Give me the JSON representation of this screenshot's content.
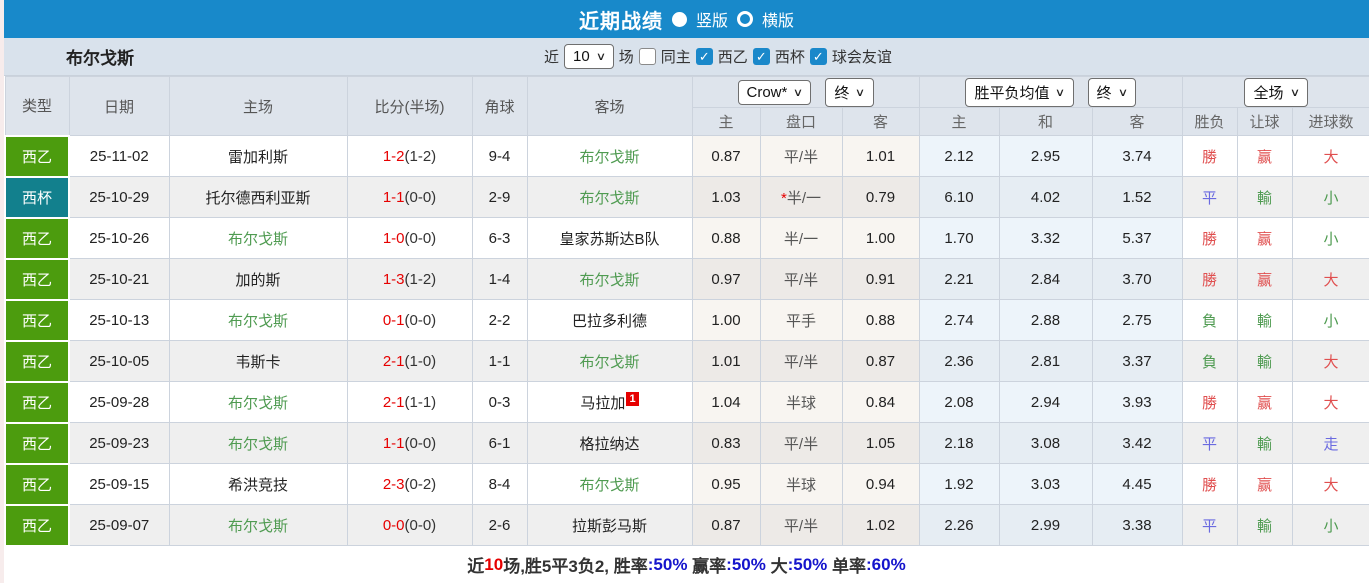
{
  "colors": {
    "topbar_blue": "#1889ca",
    "filterbar_bg": "#d9e2ec",
    "header_bg": "#dee4ec",
    "league_green": "#4c9c0e",
    "cup_teal": "#12808d",
    "score_red": "#e60000",
    "self_team_green": "#4f9b51",
    "result_red": "#e04f4f",
    "result_blue": "#6a6ae0",
    "result_green": "#4f9b51",
    "footer_blue": "#1414cc"
  },
  "top_bar": {
    "title": "近期战绩",
    "vertical_label": "竖版",
    "horizontal_label": "横版"
  },
  "filter_bar": {
    "team": "布尔戈斯",
    "near_label": "近",
    "count": "10",
    "games_label": "场",
    "same_home_label": "同主",
    "league_1": "西乙",
    "league_2": "西杯",
    "league_3": "球会友谊"
  },
  "table": {
    "headers_left": [
      "类型",
      "日期",
      "主场",
      "比分(半场)",
      "角球",
      "客场"
    ],
    "crow_dropdown": "Crow*",
    "crow_time_dropdown": "终",
    "mean_dropdown": "胜平负均值",
    "mean_time_dropdown": "终",
    "scope_dropdown": "全场",
    "sub_headers": [
      "主",
      "盘口",
      "客",
      "主",
      "和",
      "客",
      "胜负",
      "让球",
      "进球数"
    ],
    "rows": [
      {
        "type": "西乙",
        "type_color": "green",
        "date": "25-11-02",
        "home": "雷加利斯",
        "home_self": "false",
        "score": "1-2",
        "half": "(1-2)",
        "corner": "9-4",
        "away": "布尔戈斯",
        "away_self": "true",
        "away_card": "",
        "crow_home": "0.87",
        "pan_star": "",
        "pan": "平/半",
        "crow_away": "1.01",
        "mean_home": "2.12",
        "mean_draw": "2.95",
        "mean_away": "3.74",
        "wdl": "勝",
        "wdl_color": "red",
        "let": "赢",
        "let_color": "red",
        "goal": "大",
        "goal_color": "red"
      },
      {
        "type": "西杯",
        "type_color": "teal",
        "date": "25-10-29",
        "home": "托尔德西利亚斯",
        "home_self": "false",
        "score": "1-1",
        "half": "(0-0)",
        "corner": "2-9",
        "away": "布尔戈斯",
        "away_self": "true",
        "away_card": "",
        "crow_home": "1.03",
        "pan_star": "*",
        "pan": "半/一",
        "crow_away": "0.79",
        "mean_home": "6.10",
        "mean_draw": "4.02",
        "mean_away": "1.52",
        "wdl": "平",
        "wdl_color": "blue",
        "let": "輸",
        "let_color": "green",
        "goal": "小",
        "goal_color": "green"
      },
      {
        "type": "西乙",
        "type_color": "green",
        "date": "25-10-26",
        "home": "布尔戈斯",
        "home_self": "true",
        "score": "1-0",
        "half": "(0-0)",
        "corner": "6-3",
        "away": "皇家苏斯达B队",
        "away_self": "false",
        "away_card": "",
        "crow_home": "0.88",
        "pan_star": "",
        "pan": "半/一",
        "crow_away": "1.00",
        "mean_home": "1.70",
        "mean_draw": "3.32",
        "mean_away": "5.37",
        "wdl": "勝",
        "wdl_color": "red",
        "let": "赢",
        "let_color": "red",
        "goal": "小",
        "goal_color": "green"
      },
      {
        "type": "西乙",
        "type_color": "green",
        "date": "25-10-21",
        "home": "加的斯",
        "home_self": "false",
        "score": "1-3",
        "half": "(1-2)",
        "corner": "1-4",
        "away": "布尔戈斯",
        "away_self": "true",
        "away_card": "",
        "crow_home": "0.97",
        "pan_star": "",
        "pan": "平/半",
        "crow_away": "0.91",
        "mean_home": "2.21",
        "mean_draw": "2.84",
        "mean_away": "3.70",
        "wdl": "勝",
        "wdl_color": "red",
        "let": "赢",
        "let_color": "red",
        "goal": "大",
        "goal_color": "red"
      },
      {
        "type": "西乙",
        "type_color": "green",
        "date": "25-10-13",
        "home": "布尔戈斯",
        "home_self": "true",
        "score": "0-1",
        "half": "(0-0)",
        "corner": "2-2",
        "away": "巴拉多利德",
        "away_self": "false",
        "away_card": "",
        "crow_home": "1.00",
        "pan_star": "",
        "pan": "平手",
        "crow_away": "0.88",
        "mean_home": "2.74",
        "mean_draw": "2.88",
        "mean_away": "2.75",
        "wdl": "負",
        "wdl_color": "green",
        "let": "輸",
        "let_color": "green",
        "goal": "小",
        "goal_color": "green"
      },
      {
        "type": "西乙",
        "type_color": "green",
        "date": "25-10-05",
        "home": "韦斯卡",
        "home_self": "false",
        "score": "2-1",
        "half": "(1-0)",
        "corner": "1-1",
        "away": "布尔戈斯",
        "away_self": "true",
        "away_card": "",
        "crow_home": "1.01",
        "pan_star": "",
        "pan": "平/半",
        "crow_away": "0.87",
        "mean_home": "2.36",
        "mean_draw": "2.81",
        "mean_away": "3.37",
        "wdl": "負",
        "wdl_color": "green",
        "let": "輸",
        "let_color": "green",
        "goal": "大",
        "goal_color": "red"
      },
      {
        "type": "西乙",
        "type_color": "green",
        "date": "25-09-28",
        "home": "布尔戈斯",
        "home_self": "true",
        "score": "2-1",
        "half": "(1-1)",
        "corner": "0-3",
        "away": "马拉加",
        "away_self": "false",
        "away_card": "1",
        "crow_home": "1.04",
        "pan_star": "",
        "pan": "半球",
        "crow_away": "0.84",
        "mean_home": "2.08",
        "mean_draw": "2.94",
        "mean_away": "3.93",
        "wdl": "勝",
        "wdl_color": "red",
        "let": "赢",
        "let_color": "red",
        "goal": "大",
        "goal_color": "red"
      },
      {
        "type": "西乙",
        "type_color": "green",
        "date": "25-09-23",
        "home": "布尔戈斯",
        "home_self": "true",
        "score": "1-1",
        "half": "(0-0)",
        "corner": "6-1",
        "away": "格拉纳达",
        "away_self": "false",
        "away_card": "",
        "crow_home": "0.83",
        "pan_star": "",
        "pan": "平/半",
        "crow_away": "1.05",
        "mean_home": "2.18",
        "mean_draw": "3.08",
        "mean_away": "3.42",
        "wdl": "平",
        "wdl_color": "blue",
        "let": "輸",
        "let_color": "green",
        "goal": "走",
        "goal_color": "blue"
      },
      {
        "type": "西乙",
        "type_color": "green",
        "date": "25-09-15",
        "home": "希洪竞技",
        "home_self": "false",
        "score": "2-3",
        "half": "(0-2)",
        "corner": "8-4",
        "away": "布尔戈斯",
        "away_self": "true",
        "away_card": "",
        "crow_home": "0.95",
        "pan_star": "",
        "pan": "半球",
        "crow_away": "0.94",
        "mean_home": "1.92",
        "mean_draw": "3.03",
        "mean_away": "4.45",
        "wdl": "勝",
        "wdl_color": "red",
        "let": "赢",
        "let_color": "red",
        "goal": "大",
        "goal_color": "red"
      },
      {
        "type": "西乙",
        "type_color": "green",
        "date": "25-09-07",
        "home": "布尔戈斯",
        "home_self": "true",
        "score": "0-0",
        "half": "(0-0)",
        "corner": "2-6",
        "away": "拉斯彭马斯",
        "away_self": "false",
        "away_card": "",
        "crow_home": "0.87",
        "pan_star": "",
        "pan": "平/半",
        "crow_away": "1.02",
        "mean_home": "2.26",
        "mean_draw": "2.99",
        "mean_away": "3.38",
        "wdl": "平",
        "wdl_color": "blue",
        "let": "輸",
        "let_color": "green",
        "goal": "小",
        "goal_color": "green"
      }
    ]
  },
  "footer": {
    "segments": [
      {
        "text": "近",
        "color": "dark"
      },
      {
        "text": "10",
        "color": "red"
      },
      {
        "text": "场,胜5平3负2, ",
        "color": "dark"
      },
      {
        "text": "胜率",
        "color": "dark"
      },
      {
        "text": ":50%",
        "color": "blue"
      },
      {
        "text": " 赢率",
        "color": "dark"
      },
      {
        "text": ":50%",
        "color": "blue"
      },
      {
        "text": " 大",
        "color": "dark"
      },
      {
        "text": ":50%",
        "color": "blue"
      },
      {
        "text": " 单率",
        "color": "dark"
      },
      {
        "text": ":60%",
        "color": "blue"
      }
    ]
  }
}
